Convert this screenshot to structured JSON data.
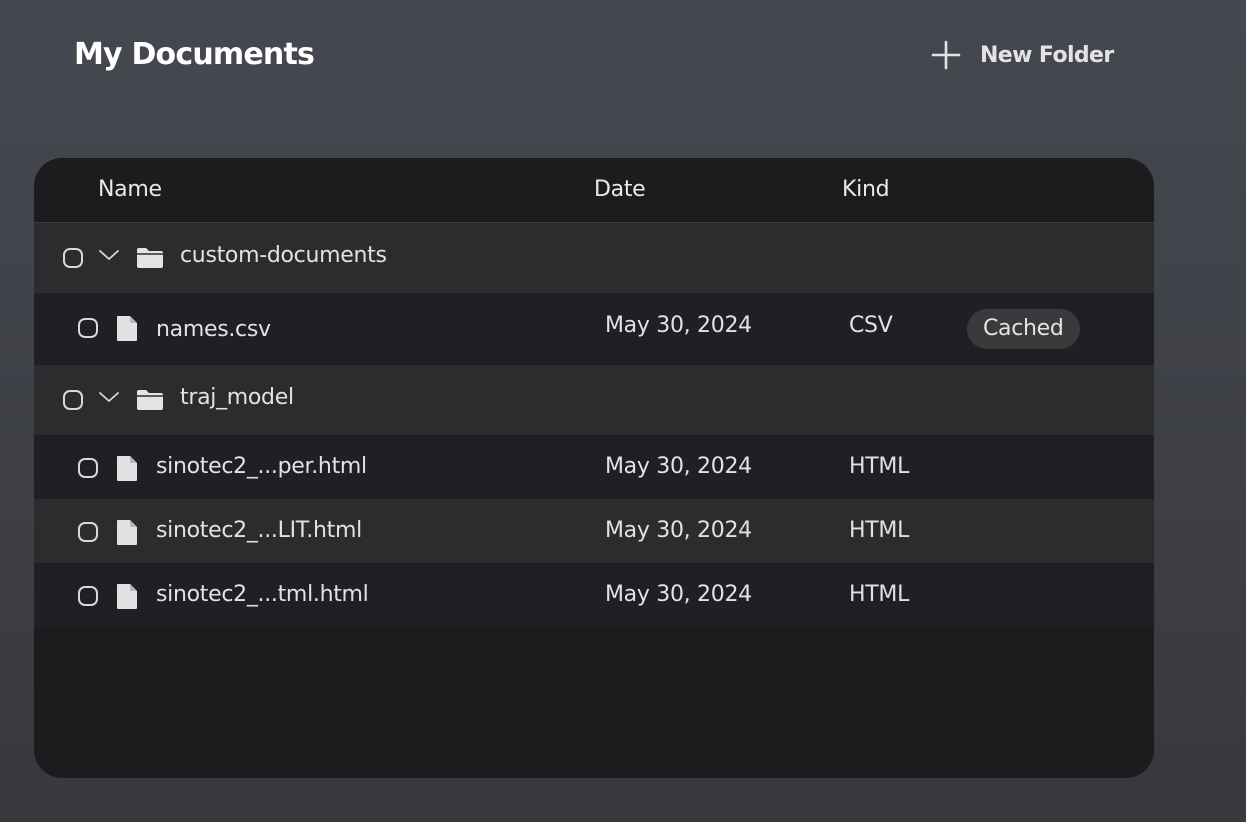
{
  "header": {
    "title": "My Documents",
    "new_folder_label": "New Folder"
  },
  "table": {
    "columns": {
      "name": "Name",
      "date": "Date",
      "kind": "Kind"
    },
    "folders": [
      {
        "name": "custom-documents",
        "expanded": true,
        "files": [
          {
            "name": "names.csv",
            "date": "May 30, 2024",
            "kind": "CSV",
            "badge": "Cached"
          }
        ]
      },
      {
        "name": "traj_model",
        "expanded": true,
        "files": [
          {
            "name": "sinotec2_...per.html",
            "date": "May 30, 2024",
            "kind": "HTML"
          },
          {
            "name": "sinotec2_...LIT.html",
            "date": "May 30, 2024",
            "kind": "HTML"
          },
          {
            "name": "sinotec2_...tml.html",
            "date": "May 30, 2024",
            "kind": "HTML"
          }
        ]
      }
    ]
  },
  "icons": {
    "new_folder": "plus-icon",
    "expand": "chevron-down-icon",
    "folder": "folder-icon",
    "file": "file-icon"
  },
  "colors": {
    "background": "#3e4046",
    "panel": "#1c1c1e",
    "folder_row": "#2c2c2e",
    "file_row": "#1f2023",
    "badge": "#3a3a3d",
    "text": "#e6e6e8"
  }
}
